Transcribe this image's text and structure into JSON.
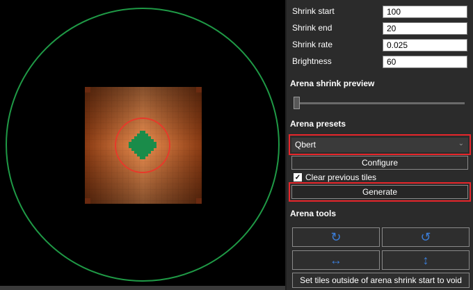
{
  "fields": [
    {
      "label": "Shrink start",
      "value": "100"
    },
    {
      "label": "Shrink end",
      "value": "20"
    },
    {
      "label": "Shrink rate",
      "value": "0.025"
    },
    {
      "label": "Brightness",
      "value": "60"
    }
  ],
  "sections": {
    "preview": "Arena shrink preview",
    "presets": "Arena presets",
    "tools": "Arena tools"
  },
  "preview_slider": {
    "value": 0
  },
  "presets": {
    "selected": "Qbert",
    "chevron_icon": "chevron-down-icon",
    "configure_label": "Configure",
    "clear_label": "Clear previous tiles",
    "clear_checked": true,
    "generate_label": "Generate"
  },
  "tools": {
    "rotate_cw_icon": "rotate-clockwise-icon",
    "rotate_ccw_icon": "rotate-counterclockwise-icon",
    "flip_h_icon": "flip-horizontal-icon",
    "flip_v_icon": "flip-vertical-icon",
    "void_label": "Set tiles outside of arena shrink start to void"
  },
  "colors": {
    "highlight": "#e8262b",
    "outer_circle": "#1f9a46",
    "inner_circle": "#e8392a",
    "player_marker": "#1a8c4a",
    "arena_orange": "#e8813a",
    "icon_blue": "#3b7dd8"
  }
}
